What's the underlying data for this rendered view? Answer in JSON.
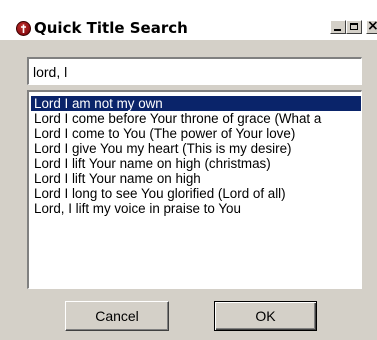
{
  "window": {
    "title": "Quick Title Search",
    "icon": "red-round-app-icon",
    "controls": {
      "minimize": "minimize-icon",
      "maximize": "maximize-icon",
      "close": "×"
    }
  },
  "search": {
    "value": "lord, l"
  },
  "results": {
    "selected_index": 0,
    "items": [
      "Lord I am not my own",
      "Lord I come before Your throne of grace (What a",
      "Lord I come to You (The power of Your love)",
      "Lord I give You my heart (This is my desire)",
      "Lord I lift Your name on high (christmas)",
      "Lord I lift Your name on high",
      "Lord I long to see You glorified (Lord of all)",
      "Lord, I lift my voice in praise to You"
    ]
  },
  "buttons": {
    "cancel_label": "Cancel",
    "ok_label": "OK"
  }
}
